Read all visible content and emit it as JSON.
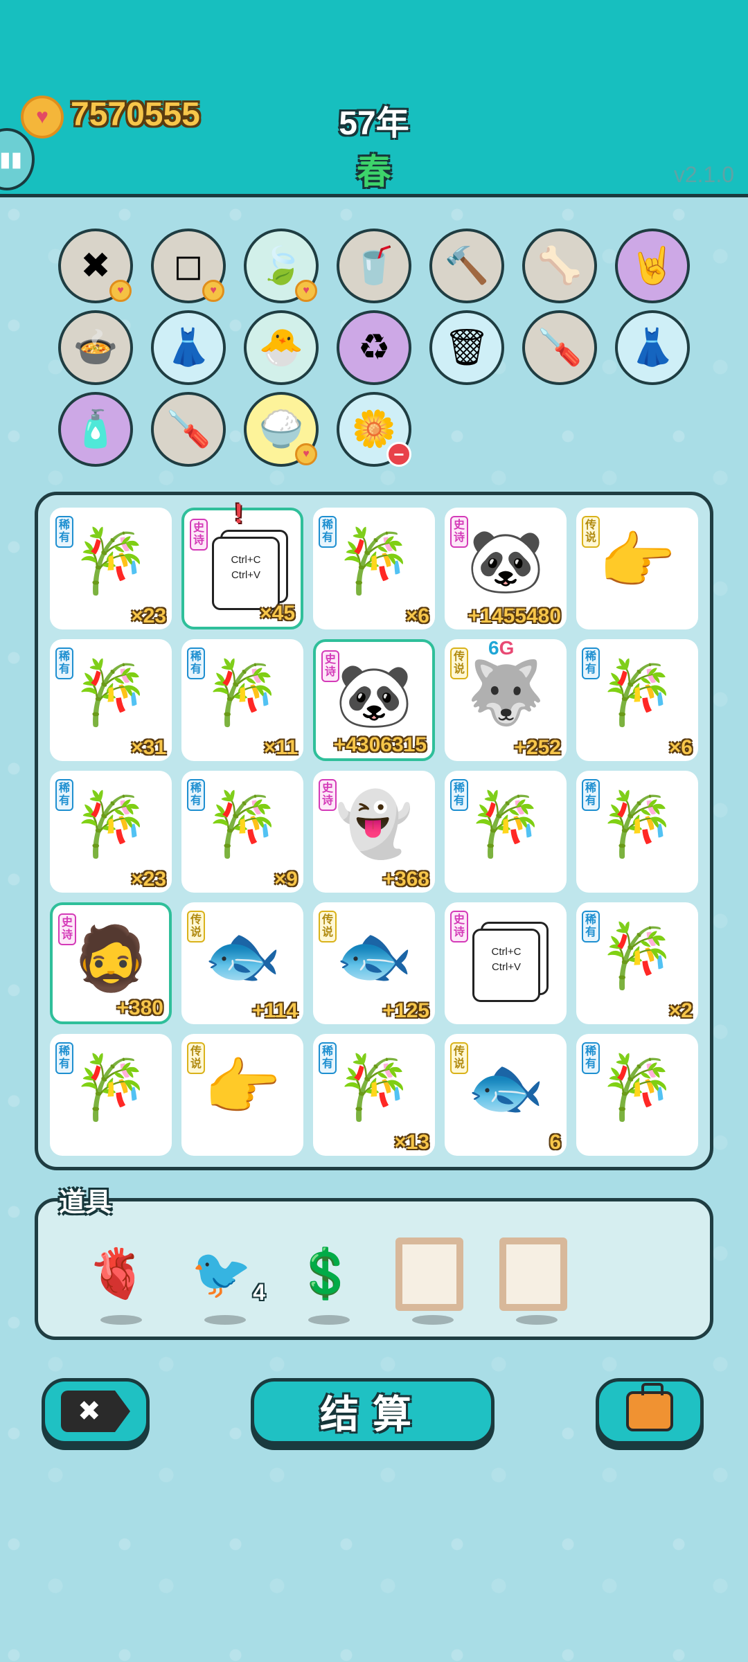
{
  "header": {
    "coins": "7570555",
    "year": "57年",
    "season": "春",
    "version": "v2.1.0"
  },
  "items": [
    {
      "icon": "tag-x-icon",
      "glyph": "✖",
      "color": "gray",
      "badge": "heart"
    },
    {
      "icon": "sugar-cubes-icon",
      "glyph": "◻",
      "color": "gray",
      "badge": "heart"
    },
    {
      "icon": "leaf-icon",
      "glyph": "🍃",
      "color": "green",
      "badge": "heart"
    },
    {
      "icon": "bubble-tea-icon",
      "glyph": "🥤",
      "color": "gray",
      "badge": ""
    },
    {
      "icon": "hammer-icon",
      "glyph": "🔨",
      "color": "gray",
      "badge": ""
    },
    {
      "icon": "pet-food-bowl-icon",
      "glyph": "🦴",
      "color": "gray",
      "badge": ""
    },
    {
      "icon": "rock-hand-icon",
      "glyph": "🤘",
      "color": "purple",
      "badge": ""
    },
    {
      "icon": "cooking-pot-icon",
      "glyph": "🍲",
      "color": "gray",
      "badge": ""
    },
    {
      "icon": "skirt-icon",
      "glyph": "👗",
      "color": "blue",
      "badge": ""
    },
    {
      "icon": "chick-egg-icon",
      "glyph": "🐣",
      "color": "green",
      "badge": ""
    },
    {
      "icon": "recycle-icon",
      "glyph": "♻",
      "color": "purple",
      "badge": ""
    },
    {
      "icon": "garbage-bag-icon",
      "glyph": "🗑",
      "color": "blue",
      "badge": ""
    },
    {
      "icon": "screwdriver-icon",
      "glyph": "🪛",
      "color": "gray",
      "badge": ""
    },
    {
      "icon": "skirt-icon",
      "glyph": "👗",
      "color": "blue",
      "badge": ""
    },
    {
      "icon": "spray-bottle-icon",
      "glyph": "🧴",
      "color": "purple",
      "badge": ""
    },
    {
      "icon": "screwdriver-icon",
      "glyph": "🪛",
      "color": "gray",
      "badge": ""
    },
    {
      "icon": "rice-bowl-icon",
      "glyph": "🍚",
      "color": "yellow",
      "badge": "heart"
    },
    {
      "icon": "flower-pot-icon",
      "glyph": "🌼",
      "color": "blue",
      "badge": "minus"
    }
  ],
  "grid": [
    {
      "tag": "稀有",
      "rarity": "rare",
      "icon": "bamboo-icon",
      "glyph": "🎋",
      "count": "×23",
      "highlight": false
    },
    {
      "tag": "史诗",
      "rarity": "epic",
      "icon": "ctrl-c-ctrl-v-icon",
      "glyph": "",
      "count": "×45",
      "highlight": true,
      "card": [
        "Ctrl+C",
        "Ctrl+V"
      ]
    },
    {
      "tag": "稀有",
      "rarity": "rare",
      "icon": "bamboo-icon",
      "glyph": "🎋",
      "count": "×6",
      "highlight": false
    },
    {
      "tag": "史诗",
      "rarity": "epic",
      "icon": "panda-king-icon",
      "glyph": "🐼",
      "count": "+1455480",
      "highlight": false
    },
    {
      "tag": "传说",
      "rarity": "legend",
      "icon": "pointing-hand-icon",
      "glyph": "👉",
      "count": "",
      "highlight": false
    },
    {
      "tag": "稀有",
      "rarity": "rare",
      "icon": "bamboo-icon",
      "glyph": "🎋",
      "count": "×31",
      "highlight": false
    },
    {
      "tag": "稀有",
      "rarity": "rare",
      "icon": "bamboo-icon",
      "glyph": "🎋",
      "count": "×11",
      "highlight": false
    },
    {
      "tag": "史诗",
      "rarity": "epic",
      "icon": "panda-king-icon",
      "glyph": "🐼",
      "count": "+4306315",
      "highlight": true
    },
    {
      "tag": "传说",
      "rarity": "legend",
      "icon": "husky-king-icon",
      "glyph": "🐺",
      "count": "+252",
      "highlight": false
    },
    {
      "tag": "稀有",
      "rarity": "rare",
      "icon": "bamboo-icon",
      "glyph": "🎋",
      "count": "×6",
      "highlight": false
    },
    {
      "tag": "稀有",
      "rarity": "rare",
      "icon": "bamboo-icon",
      "glyph": "🎋",
      "count": "×23",
      "highlight": false
    },
    {
      "tag": "稀有",
      "rarity": "rare",
      "icon": "bamboo-icon",
      "glyph": "🎋",
      "count": "×9",
      "highlight": false
    },
    {
      "tag": "史诗",
      "rarity": "epic",
      "icon": "ghost-icon",
      "glyph": "👻",
      "count": "+368",
      "highlight": false
    },
    {
      "tag": "稀有",
      "rarity": "rare",
      "icon": "bamboo-icon",
      "glyph": "🎋",
      "count": "",
      "highlight": false
    },
    {
      "tag": "稀有",
      "rarity": "rare",
      "icon": "bamboo-icon",
      "glyph": "🎋",
      "count": "",
      "highlight": false
    },
    {
      "tag": "史诗",
      "rarity": "epic",
      "icon": "bearded-man-icon",
      "glyph": "🧔",
      "count": "+380",
      "highlight": true
    },
    {
      "tag": "传说",
      "rarity": "legend",
      "icon": "koi-fish-icon",
      "glyph": "🐟",
      "count": "+114",
      "highlight": false
    },
    {
      "tag": "传说",
      "rarity": "legend",
      "icon": "koi-fish-icon",
      "glyph": "🐟",
      "count": "+125",
      "highlight": false
    },
    {
      "tag": "史诗",
      "rarity": "epic",
      "icon": "ctrl-c-ctrl-v-icon",
      "glyph": "",
      "count": "",
      "highlight": false,
      "card": [
        "Ctrl+C",
        "Ctrl+V"
      ]
    },
    {
      "tag": "稀有",
      "rarity": "rare",
      "icon": "bamboo-icon",
      "glyph": "🎋",
      "count": "×2",
      "highlight": false
    },
    {
      "tag": "稀有",
      "rarity": "rare",
      "icon": "bamboo-icon",
      "glyph": "🎋",
      "count": "",
      "highlight": false
    },
    {
      "tag": "传说",
      "rarity": "legend",
      "icon": "pointing-hand-icon",
      "glyph": "👉",
      "count": "",
      "highlight": false
    },
    {
      "tag": "稀有",
      "rarity": "rare",
      "icon": "bamboo-icon",
      "glyph": "🎋",
      "count": "×13",
      "highlight": false
    },
    {
      "tag": "传说",
      "rarity": "legend",
      "icon": "koi-fish-icon",
      "glyph": "🐟",
      "count": "6",
      "highlight": false
    },
    {
      "tag": "稀有",
      "rarity": "rare",
      "icon": "bamboo-icon",
      "glyph": "🎋",
      "count": "",
      "highlight": false
    }
  ],
  "grid_markers": {
    "exclaim": "!",
    "level_num": "6",
    "level_g": "G"
  },
  "tools": {
    "title": "道具",
    "items": [
      {
        "icon": "liver-icon",
        "glyph": "🫀",
        "count": ""
      },
      {
        "icon": "white-bird-icon",
        "glyph": "🐦",
        "count": "4"
      },
      {
        "icon": "dollar-coin-icon",
        "glyph": "💲",
        "count": ""
      },
      {
        "icon": "empty-frame-icon",
        "glyph": "",
        "count": ""
      },
      {
        "icon": "empty-frame-icon",
        "glyph": "",
        "count": ""
      }
    ]
  },
  "buttons": {
    "remove_glyph": "✖",
    "settle_label": "结算",
    "bag_icon": "briefcase-icon"
  },
  "colors": {
    "header_bg": "#17bfbf",
    "page_bg": "#a9dde6",
    "rare": "#1e8fd0",
    "epic": "#d43ab8",
    "legend": "#d9b21a",
    "highlight": "#2fbf9a",
    "number_gold": "#f7c64a"
  }
}
